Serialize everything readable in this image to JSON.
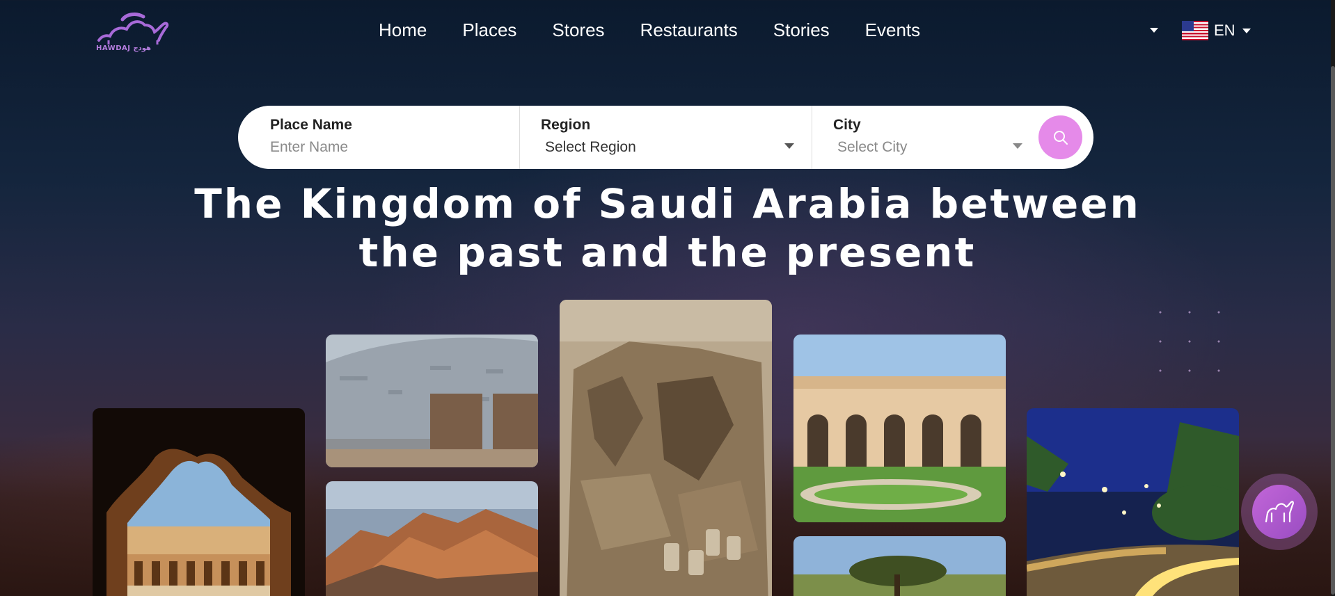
{
  "brand": {
    "logo_text": "HAWDAJ هودج"
  },
  "nav": {
    "items": [
      "Home",
      "Places",
      "Stores",
      "Restaurants",
      "Stories",
      "Events"
    ]
  },
  "language": {
    "label": "EN"
  },
  "search": {
    "place_label": "Place Name",
    "place_placeholder": "Enter Name",
    "region_label": "Region",
    "region_value": "Select Region",
    "city_label": "City",
    "city_value": "Select City"
  },
  "hero": {
    "title_line1": "The Kingdom of Saudi Arabia between",
    "title_line2": "the past and the present"
  },
  "colors": {
    "accent": "#e58ae9",
    "brand_purple": "#9a4dc2"
  },
  "icons": [
    "camel-logo-icon",
    "search-icon",
    "caret-down-icon",
    "us-flag-icon",
    "camel-chat-icon"
  ]
}
